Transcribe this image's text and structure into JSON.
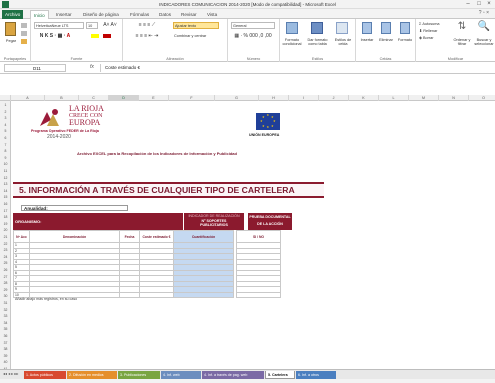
{
  "window": {
    "title": "INDICADORES COMUNICACION 2014-2020 [Modo de compatibilidad] - Microsoft Excel"
  },
  "ribbon_tabs": [
    "Archivo",
    "Inicio",
    "Insertar",
    "Diseño de página",
    "Fórmulas",
    "Datos",
    "Revisar",
    "Vista"
  ],
  "ribbon": {
    "paste": "Pegar",
    "font_name": "HelveticaNeue LTS",
    "font_size": "10",
    "wrap_text": "Ajustar texto",
    "merge": "Combinar y centrar",
    "number_format": "General",
    "conditional_format": "Formato condicional",
    "format_as_table": "Dar formato como tabla",
    "cell_styles": "Estilos de celda",
    "insert": "Insertar",
    "delete": "Eliminar",
    "format": "Formato",
    "autosum": "Autosuma",
    "fill": "Rellenar",
    "clear": "Borrar",
    "sort_filter": "Ordenar y filtrar",
    "find_select": "Buscar y seleccionar",
    "groups": [
      "Portapapeles",
      "Fuente",
      "Alineación",
      "Número",
      "Estilos",
      "Celdas",
      "Modificar"
    ]
  },
  "formula_bar": {
    "name_box": "D11",
    "fx": "fx",
    "content": "Coste estimado €"
  },
  "columns": [
    "A",
    "B",
    "C",
    "D",
    "E",
    "F",
    "G",
    "H",
    "I",
    "J",
    "K",
    "L",
    "M",
    "N",
    "O"
  ],
  "selected_column": "D",
  "row_numbers": [
    "1",
    "2",
    "3",
    "4",
    "5",
    "6",
    "7",
    "8",
    "9",
    "10",
    "11",
    "12",
    "13",
    "14",
    "15",
    "16",
    "17",
    "18",
    "19",
    "20",
    "21",
    "22",
    "23",
    "24",
    "25",
    "26",
    "27",
    "28",
    "29",
    "30",
    "31",
    "32",
    "33",
    "34",
    "35",
    "36",
    "37",
    "38",
    "39",
    "40",
    "41",
    "42"
  ],
  "sheet": {
    "la_rioja_line1": "LA RIOJA",
    "la_rioja_line2": "CRECE CON",
    "la_rioja_line3": "EUROPA",
    "programa": "Programa Operativo FEDER de La Rioja",
    "years": "2014-2020",
    "eu_label": "UNIÓN EUROPEA",
    "archivo_title": "Archivo EXCEL para la Recopilación de los Indicadores de Información y Publicidad",
    "section_title": "5. INFORMACIÓN A TRAVÉS DE CUALQUIER TIPO DE CARTELERA",
    "anualidad": "Anualidad:",
    "organismo": "ORGANISMO:",
    "indicador_realizacion": "INDICADOR DE REALIZACIÓN",
    "n_soportes": "Nº SOPORTES PUBLICITARIOS",
    "cuantificacion": "Cuantificación",
    "prueba_documental": "PRUEBA DOCUMENTAL",
    "de_la_accion": "DE LA ACCIÓN",
    "si_no": "SI / NO",
    "col_n_acc": "Nº Acc",
    "col_denominacion": "Denominación",
    "col_fecha": "Fecha",
    "col_coste": "Coste estimado €",
    "row_numbers": [
      "1",
      "2",
      "3",
      "4",
      "5",
      "6",
      "7",
      "8",
      "9",
      "10"
    ],
    "note": "Añadir abajo más registros, en su caso"
  },
  "sheet_tabs": [
    {
      "label": "1. Actos públicos",
      "color": "#d84a2f"
    },
    {
      "label": "2. Difusión en medios",
      "color": "#e58f2c"
    },
    {
      "label": "3. Publicaciones",
      "color": "#7aa542"
    },
    {
      "label": "4. Inf. web",
      "color": "#6c8ebf"
    },
    {
      "label": "4. Inf. a través de pag. web",
      "color": "#7b6aa5"
    },
    {
      "label": "5. Cartelera",
      "color": "#ffffff",
      "active": true
    },
    {
      "label": "6. Inf. a otros",
      "color": "#4a7fc0"
    }
  ],
  "colors": {
    "excel_green": "#1e7145",
    "maroon": "#8b1a2e",
    "header_blue": "#c5d9f1"
  }
}
